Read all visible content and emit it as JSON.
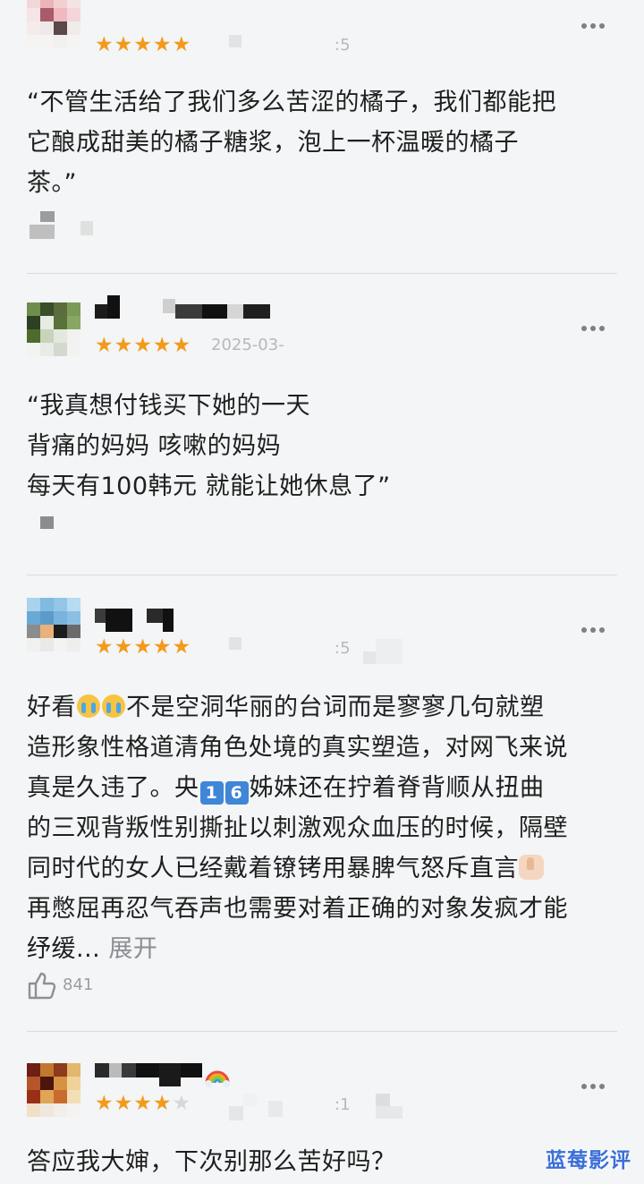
{
  "reviews": [
    {
      "stars": 5,
      "date": ":5",
      "text": "“不管生活给了我们多么苦涩的橘子，我们都能把\n它酿成甜美的橘子糖浆，泡上一杯温暖的橘子\n茶。”",
      "avatar_colors": [
        "#f2d7d8",
        "#e9b5b8",
        "#f4cfd1",
        "#f3e3e3",
        "#f6e4e6",
        "#a95a6b",
        "#f1b8c2",
        "#f4d6da",
        "#f7eaea",
        "#eeeaea",
        "#5b4848",
        "#f0ece9",
        "#f5f4f2",
        "#f5f3f3",
        "#f2f0ef",
        "#f4f4f3"
      ]
    },
    {
      "stars": 5,
      "date": "2025-03-",
      "text": "“我真想付钱买下她的一天\n背痛的妈妈 咳嗽的妈妈\n每天有100韩元 就能让她休息了”",
      "avatar_colors": [
        "#6d8d4c",
        "#3a4e2a",
        "#5b6d3c",
        "#7b9a57",
        "#2f3f22",
        "#e7ebe4",
        "#58723a",
        "#8aa663",
        "#4d6b2d",
        "#c7d3bb",
        "#e3e8de",
        "#f1f2ef",
        "#f3f3f2",
        "#e9ebe6",
        "#d3d9cc",
        "#f2f3f1"
      ]
    },
    {
      "stars": 5,
      "date": ":5",
      "text_parts": {
        "a": "好看",
        "b": "不是空洞华丽的台词而是寥寥几句就塑\n造形象性格道清角色处境的真实塑造，对网飞来说\n真是久违了。央",
        "key1": "1",
        "key2": "6",
        "c": "姊妹还在拧着脊背顺从扭曲\n的三观背叛性别撕扯以刺激观众血压的时候，隔壁\n同时代的女人已经戴着镣铐用暴脾气怒斥直言",
        "d": "\n再憋屈再忍气吞声也需要对着正确的对象发疯才能\n纾缓...",
        "expand": " 展开"
      },
      "likes": "841",
      "avatar_colors": [
        "#a9d3ec",
        "#7fbbe0",
        "#93c6e6",
        "#b7dcf1",
        "#6aa9d6",
        "#5c9bc9",
        "#78b4dd",
        "#8cc0e3",
        "#8c8c8c",
        "#e8b27a",
        "#1c1c1c",
        "#6a6a6a",
        "#f0f0ef",
        "#e9e9e8",
        "#f3f3f2",
        "#eeeeed"
      ]
    },
    {
      "stars": 4,
      "date": ":1",
      "text": "答应我大婶，下次别那么苦好吗？",
      "avatar_colors": [
        "#6d1f14",
        "#c2772e",
        "#8e3a1c",
        "#e3b76f",
        "#b4562a",
        "#4b140d",
        "#d69243",
        "#f0d39a",
        "#9a2f18",
        "#e0a556",
        "#c96b2e",
        "#f3dfb5",
        "#f0e0c7",
        "#efe8df",
        "#f2efea",
        "#f4f3f1"
      ]
    }
  ],
  "icons": {
    "more": "more-horizontal-icon",
    "like": "thumb-up-icon",
    "emoji_cry": "crying-face-emoji",
    "emoji_thumb": "thumbs-up-emoji",
    "rainbow": "rainbow-emoji"
  },
  "colors": {
    "star": "#f39a1c",
    "star_off": "#d6d9dc",
    "background": "#f3f5f6",
    "watermark": "#3b6fd8"
  },
  "watermark": "蓝莓影评"
}
